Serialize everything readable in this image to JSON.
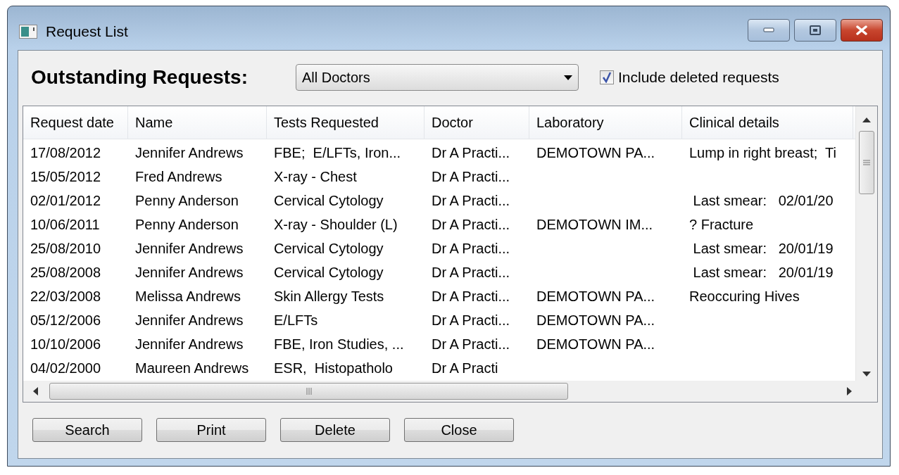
{
  "window": {
    "title": "Request List"
  },
  "heading": "Outstanding Requests:",
  "doctor_filter": {
    "value": "All Doctors"
  },
  "include_deleted": {
    "label": "Include deleted requests",
    "checked": true
  },
  "table": {
    "columns": [
      "Request date",
      "Name",
      "Tests Requested",
      "Doctor",
      "Laboratory",
      "Clinical details"
    ],
    "rows": [
      [
        "17/08/2012",
        "Jennifer Andrews",
        "FBE;  E/LFTs, Iron...",
        "Dr A Practi...",
        "DEMOTOWN PA...",
        "Lump in right breast;  Ti"
      ],
      [
        "15/05/2012",
        "Fred Andrews",
        "X-ray - Chest",
        "Dr A Practi...",
        null,
        null
      ],
      [
        "02/01/2012",
        "Penny Anderson",
        "Cervical Cytology",
        "Dr A Practi...",
        null,
        " Last smear:   02/01/20"
      ],
      [
        "10/06/2011",
        "Penny Anderson",
        "X-ray - Shoulder (L)",
        "Dr A Practi...",
        "DEMOTOWN IM...",
        "? Fracture"
      ],
      [
        "25/08/2010",
        "Jennifer Andrews",
        "Cervical Cytology",
        "Dr A Practi...",
        null,
        " Last smear:   20/01/19"
      ],
      [
        "25/08/2008",
        "Jennifer Andrews",
        "Cervical Cytology",
        "Dr A Practi...",
        null,
        " Last smear:   20/01/19"
      ],
      [
        "22/03/2008",
        "Melissa Andrews",
        "Skin Allergy Tests",
        "Dr A Practi...",
        "DEMOTOWN PA...",
        "Reoccuring Hives"
      ],
      [
        "05/12/2006",
        "Jennifer Andrews",
        "E/LFTs",
        "Dr A Practi...",
        "DEMOTOWN PA...",
        null
      ],
      [
        "10/10/2006",
        "Jennifer Andrews",
        "FBE, Iron Studies, ...",
        "Dr A Practi...",
        "DEMOTOWN PA...",
        null
      ],
      [
        "04/02/2000",
        "Maureen Andrews",
        "ESR,  Histopatholo",
        "Dr A Practi",
        null,
        null
      ]
    ]
  },
  "buttons": [
    "Search",
    "Print",
    "Delete",
    "Close"
  ]
}
